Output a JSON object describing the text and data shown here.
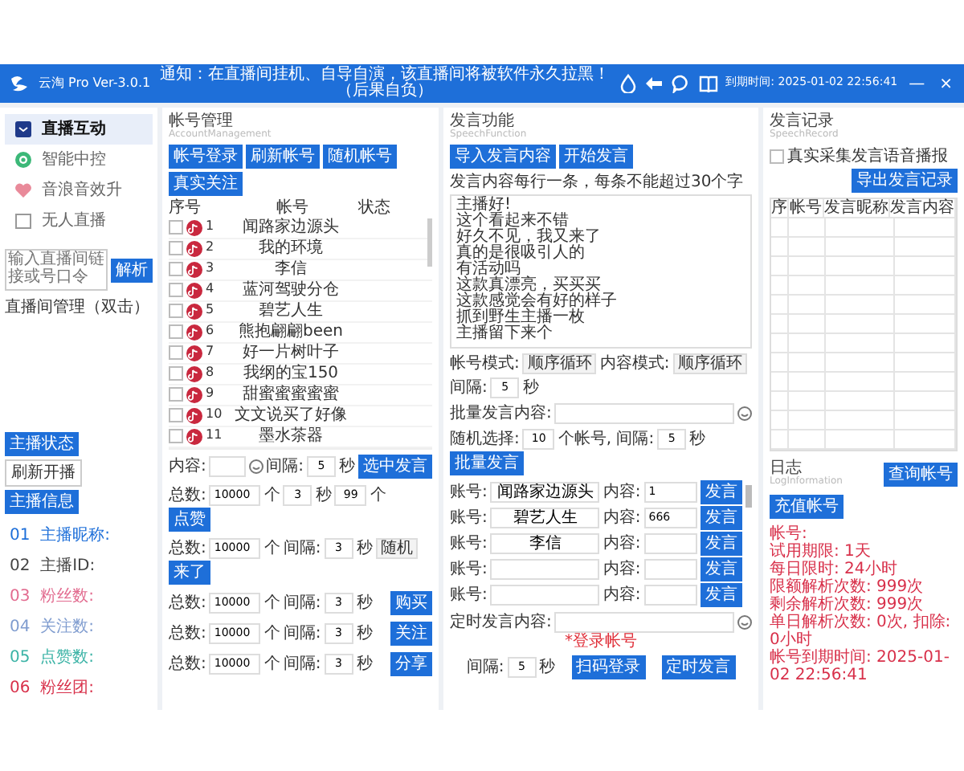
{
  "window": {
    "app_name": "云淘 Pro Ver-3.0.1",
    "notice": "通知：在直播间挂机、自导自演，该直播间将被软件永久拉黑！（后果自负）",
    "expiry": "到期时间: 2025-01-02 22:56:41",
    "controls": [
      "—",
      "×"
    ]
  },
  "sidebar": {
    "items": [
      {
        "label": "直播互动",
        "selected": true
      },
      {
        "label": "智能中控",
        "selected": false
      },
      {
        "label": "音浪音效升",
        "selected": false
      },
      {
        "label": "无人直播",
        "selected": false
      }
    ],
    "link_field": {
      "placeholder": "输入直播间链接或号口令"
    },
    "parse_button": "解析",
    "room_label": "直播间管理（双击）",
    "room_buttons": [
      "主播状态",
      "刷新开播",
      "主播信息"
    ],
    "streamer_info": [
      {
        "index": "01",
        "label": "主播昵称:",
        "color": "#1e6fd9"
      },
      {
        "index": "02",
        "label": "主播ID:",
        "color": "#444444"
      },
      {
        "index": "03",
        "label": "粉丝数:",
        "color": "#e26b8f"
      },
      {
        "index": "04",
        "label": "关注数:",
        "color": "#7f9ccf"
      },
      {
        "index": "05",
        "label": "点赞数:",
        "color": "#3bb3a6"
      },
      {
        "index": "06",
        "label": "粉丝团:",
        "color": "#d8304a"
      }
    ]
  },
  "accounts": {
    "title": "帐号管理",
    "subtitle": "AccountManagement",
    "buttons": [
      "帐号登录",
      "刷新帐号",
      "随机帐号",
      "真实关注"
    ],
    "columns": [
      "序号",
      "帐号",
      "状态"
    ],
    "rows": [
      {
        "index": "1",
        "name": "闻路家边源头",
        "checked": false
      },
      {
        "index": "2",
        "name": "我的环境",
        "checked": false
      },
      {
        "index": "3",
        "name": "李信",
        "checked": false
      },
      {
        "index": "4",
        "name": "蓝河驾驶分仓",
        "checked": false
      },
      {
        "index": "5",
        "name": "碧艺人生",
        "checked": false
      },
      {
        "index": "6",
        "name": "熊抱翩翩been",
        "checked": false
      },
      {
        "index": "7",
        "name": "好一片树叶子",
        "checked": false
      },
      {
        "index": "8",
        "name": "我纲的宝150",
        "checked": false
      },
      {
        "index": "9",
        "name": "甜蜜蜜蜜蜜蜜",
        "checked": false
      },
      {
        "index": "10",
        "name": "文文说买了好像",
        "checked": false
      },
      {
        "index": "11",
        "name": "墨水茶器",
        "checked": false
      }
    ],
    "content_label": "内容:",
    "interval_label": "间隔:",
    "interval": "5",
    "unit": "秒",
    "send_button": "选中发言",
    "actions": [
      {
        "total_label": "总数:",
        "total": "10000",
        "count_unit": "个",
        "interval": "3",
        "sec": "秒",
        "extra": "99",
        "extra_unit": "个",
        "button": "点赞"
      },
      {
        "total_label": "总数:",
        "total": "10000",
        "count_unit": "个",
        "interval_label": "间隔:",
        "interval": "3",
        "sec": "秒",
        "select": "随机",
        "button": "来了"
      },
      {
        "total_label": "总数:",
        "total": "10000",
        "count_unit": "个",
        "interval_label": "间隔:",
        "interval": "3",
        "sec": "秒",
        "button": "购买"
      },
      {
        "total_label": "总数:",
        "total": "10000",
        "count_unit": "个",
        "interval_label": "间隔:",
        "interval": "3",
        "sec": "秒",
        "button": "关注"
      },
      {
        "total_label": "总数:",
        "total": "10000",
        "count_unit": "个",
        "interval_label": "间隔:",
        "interval": "3",
        "sec": "秒",
        "button": "分享"
      }
    ]
  },
  "speech": {
    "title": "发言功能",
    "subtitle": "SpeechFunction",
    "buttons": [
      "导入发言内容",
      "开始发言"
    ],
    "note": "发言内容每行一条，每条不能超过30个字",
    "lines": [
      "主播好!",
      "这个看起来不错",
      "好久不见，我又来了",
      "真的是很吸引人的",
      "有活动吗",
      "这款真漂亮，买买买",
      "这款感觉会有好的样子",
      "抓到野生主播一枚",
      "主播留下来个"
    ],
    "account_mode_label": "帐号模式:",
    "account_mode": "顺序循环",
    "content_mode_label": "内容模式:",
    "content_mode": "顺序循环",
    "interval_label": "间隔:",
    "interval": "5",
    "unit": "秒",
    "batch_label": "批量发言内容:",
    "random_label": "随机选择:",
    "random_count": "10",
    "random_unit": "个帐号, 间隔:",
    "random_interval": "5",
    "random_sec": "秒",
    "batch_button": "批量发言",
    "manual": [
      {
        "account_label": "账号:",
        "account": "闻路家边源头",
        "content_label": "内容:",
        "content": "1",
        "button": "发言"
      },
      {
        "account_label": "账号:",
        "account": "碧艺人生",
        "content_label": "内容:",
        "content": "666",
        "button": "发言"
      },
      {
        "account_label": "账号:",
        "account": "李信",
        "content_label": "内容:",
        "button": "发言"
      },
      {
        "account_label": "账号:",
        "content_label": "内容:",
        "button": "发言"
      },
      {
        "account_label": "账号:",
        "content_label": "内容:",
        "button": "发言"
      }
    ],
    "timed_label": "定时发言内容:",
    "warning": "*登录帐号",
    "timed_interval_label": "间隔:",
    "timed_interval": "5",
    "timed_unit": "秒",
    "buttons_bottom": [
      "扫码登录",
      "定时发言"
    ]
  },
  "record": {
    "title": "发言记录",
    "subtitle": "SpeechRecord",
    "checkbox": {
      "label": "真实采集发言语音播报",
      "checked": false
    },
    "export_button": "导出发言记录",
    "columns": [
      "序",
      "帐号",
      "发言昵称",
      "发言内容"
    ],
    "log_title": "日志",
    "log_subtitle": "LogInformation",
    "log_buttons": [
      "查询帐号",
      "充值帐号"
    ],
    "log_lines": [
      "帐号:",
      "试用期限: 1天",
      "每日限时: 24小时",
      "限额解析次数: 999次",
      "剩余解析次数: 999次",
      "单日解析次数: 0次, 扣除: 0小时",
      "帐号到期时间: 2025-01-02 22:56:41"
    ]
  }
}
